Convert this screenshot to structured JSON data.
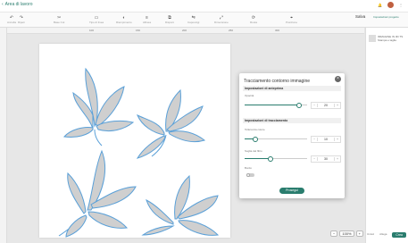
{
  "app": {
    "back_label": "Area di lavoro",
    "save_label": "Salva",
    "project_label": "Progetto Svuotato",
    "status_label": "Impostazioni progetto"
  },
  "toolbar": {
    "items": [
      {
        "icon": "undo-icon",
        "label": "Annulla"
      },
      {
        "icon": "redo-icon",
        "label": "Ripeti"
      },
      {
        "icon": "operation-icon",
        "label": "Base Cut"
      },
      {
        "icon": "linetype-icon",
        "label": "Tipo di linea"
      },
      {
        "icon": "fill-icon",
        "label": "Riempimento"
      },
      {
        "icon": "align-icon",
        "label": "Allinea"
      },
      {
        "icon": "arrange-icon",
        "label": "Disponi"
      },
      {
        "icon": "flip-icon",
        "label": "Capovolgi"
      },
      {
        "icon": "size-icon",
        "label": "Dimensione"
      },
      {
        "icon": "rotate-icon",
        "label": "Ruota"
      },
      {
        "icon": "position-icon",
        "label": "Posizione"
      }
    ]
  },
  "ruler": {
    "ticks": [
      "100",
      "150",
      "200",
      "250",
      "300"
    ]
  },
  "layers": {
    "item_title": "IMMAGINE IN 3D TS",
    "item_sub": "Stampa e taglia"
  },
  "zoom": {
    "value": "100%"
  },
  "bottom": {
    "flatten": "Unisci",
    "attach": "Allega",
    "create": "Crea"
  },
  "dialog": {
    "title": "Tracciamento contorno immagine",
    "section1": "Impostazioni di anteprima",
    "opacity_label": "Opacità",
    "opacity_value": "20",
    "opacity_pct": 0.85,
    "section2": "Impostazioni di tracciamento",
    "tolerance_label": "Tolleranza colore",
    "tolerance_value": "10",
    "tolerance_pct": 0.15,
    "threshold_label": "Soglia del filtro",
    "threshold_value": "30",
    "threshold_pct": 0.4,
    "outline_label": "Bordo",
    "apply_label": "Prosegui"
  }
}
